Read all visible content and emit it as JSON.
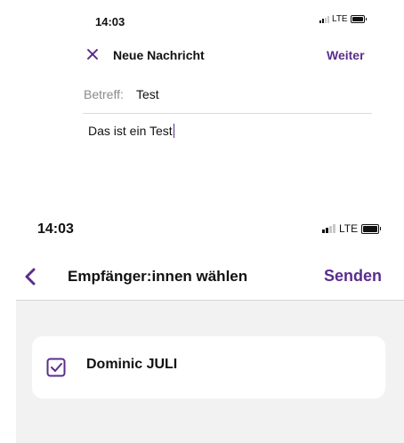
{
  "top_screen": {
    "status_bar": {
      "time": "14:03",
      "network": "LTE"
    },
    "header": {
      "title": "Neue Nachricht",
      "next_label": "Weiter"
    },
    "subject": {
      "label": "Betreff:",
      "value": "Test"
    },
    "body": {
      "text": "Das ist ein Test"
    }
  },
  "bottom_screen": {
    "status_bar": {
      "time": "14:03",
      "network": "LTE"
    },
    "header": {
      "title": "Empfänger:innen wählen",
      "send_label": "Senden"
    },
    "recipients": [
      {
        "name": "Dominic JULI",
        "checked": true
      }
    ]
  },
  "colors": {
    "accent": "#5b2d8c",
    "list_background": "#f2f2f2",
    "card_background": "#ffffff",
    "muted_text": "#8a8a8a"
  },
  "icons": {
    "close": "close-icon",
    "back": "chevron-left-icon",
    "checkbox": "checkbox-checked-icon",
    "signal": "signal-icon",
    "battery": "battery-icon"
  }
}
